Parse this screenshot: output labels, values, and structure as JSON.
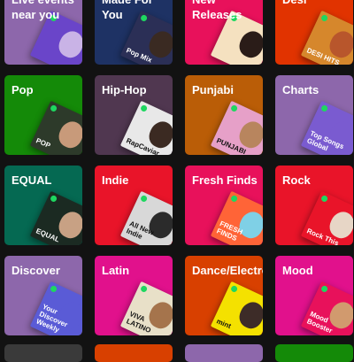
{
  "tiles": [
    {
      "name": "live-events",
      "title": "Live events near you",
      "bg": "#8d67ab",
      "cover_text": "",
      "cover_bg": "#6a45c9",
      "face": "#c9b3e6"
    },
    {
      "name": "made-for-you",
      "title": "Made For You",
      "bg": "#1e3264",
      "cover_text": "Pop Mix",
      "cover_bg": "#2b2f56",
      "face": "#3a2a22"
    },
    {
      "name": "new-releases",
      "title": "New Releases",
      "bg": "#e8115b",
      "cover_text": "",
      "cover_bg": "#f5e1c0",
      "face": "#2a1c18"
    },
    {
      "name": "desi",
      "title": "Desi",
      "bg": "#e13300",
      "cover_text": "DESI HITS",
      "cover_bg": "#d6872c",
      "face": "#b8562c"
    },
    {
      "name": "pop",
      "title": "Pop",
      "bg": "#148a08",
      "cover_text": "POP",
      "cover_bg": "#2d3a2a",
      "face": "#c89a7a"
    },
    {
      "name": "hip-hop",
      "title": "Hip-Hop",
      "bg": "#503750",
      "cover_text": "RapCaviar",
      "cover_bg": "#e8e8e8",
      "face": "#3b2a22"
    },
    {
      "name": "punjabi",
      "title": "Punjabi",
      "bg": "#ba5d07",
      "cover_text": "PUNJABI",
      "cover_bg": "#e6a0c8",
      "face": "#b8855e"
    },
    {
      "name": "charts",
      "title": "Charts",
      "bg": "#8d67ab",
      "cover_text": "Top Songs Global",
      "cover_bg": "#7a5bd0",
      "face": "#7a5bd0"
    },
    {
      "name": "equal",
      "title": "EQUAL",
      "bg": "#056952",
      "cover_text": "EQUAL",
      "cover_bg": "#1b2a22",
      "face": "#c8a184"
    },
    {
      "name": "indie",
      "title": "Indie",
      "bg": "#e91429",
      "cover_text": "All New Indie",
      "cover_bg": "#d8d8d8",
      "face": "#2b2b2b"
    },
    {
      "name": "fresh-finds",
      "title": "Fresh Finds",
      "bg": "#e8115b",
      "cover_text": "FRESH FINDS",
      "cover_bg": "#ff6437",
      "face": "#7fd0e6"
    },
    {
      "name": "rock",
      "title": "Rock",
      "bg": "#e91429",
      "cover_text": "Rock This",
      "cover_bg": "#e91429",
      "face": "#e7d6c6"
    },
    {
      "name": "discover",
      "title": "Discover",
      "bg": "#8d67ab",
      "cover_text": "Your Discover Weekly",
      "cover_bg": "#5a5bd6",
      "face": "#5a5bd6"
    },
    {
      "name": "latin",
      "title": "Latin",
      "bg": "#e1118c",
      "cover_text": "VIVA LATINO",
      "cover_bg": "#e8e0c8",
      "face": "#a5744c"
    },
    {
      "name": "dance-electronic",
      "title": "Dance/Electronic",
      "bg": "#d84000",
      "cover_text": "mint",
      "cover_bg": "#f4e100",
      "face": "#3d2c28"
    },
    {
      "name": "mood",
      "title": "Mood",
      "bg": "#e1118c",
      "cover_text": "Mood Booster",
      "cover_bg": "#e8115b",
      "face": "#d19a6e"
    }
  ],
  "bottom_row": [
    {
      "name": "next-tile-1",
      "bg": "#3a3a3a"
    },
    {
      "name": "next-tile-2",
      "bg": "#d84000"
    },
    {
      "name": "next-tile-3",
      "bg": "#8d67ab"
    },
    {
      "name": "next-tile-4",
      "bg": "#148a08"
    }
  ]
}
